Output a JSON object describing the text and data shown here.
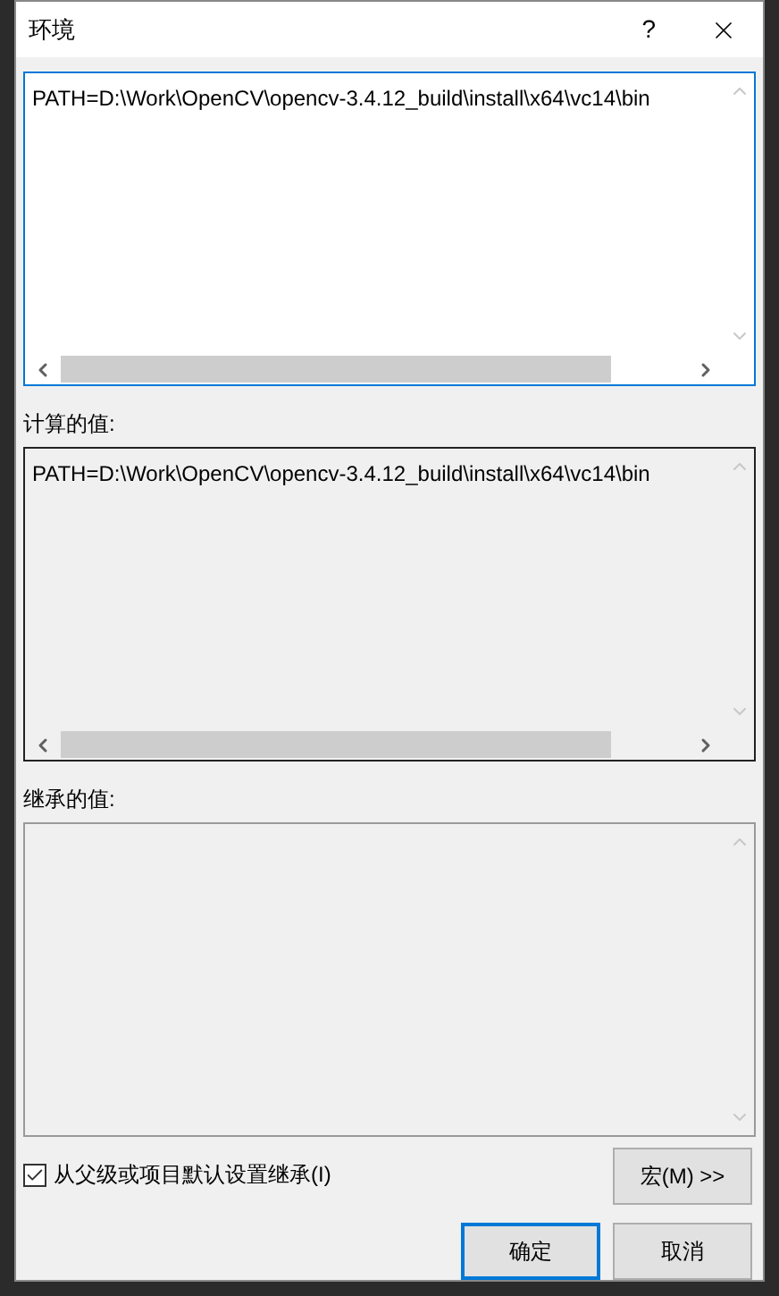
{
  "window": {
    "title": "环境",
    "help": "?"
  },
  "environment": {
    "value": "PATH=D:\\Work\\OpenCV\\opencv-3.4.12_build\\install\\x64\\vc14\\bin"
  },
  "computed": {
    "label": "计算的值:",
    "value": "PATH=D:\\Work\\OpenCV\\opencv-3.4.12_build\\install\\x64\\vc14\\bin"
  },
  "inherited": {
    "label": "继承的值:"
  },
  "inherit_checkbox": {
    "label": "从父级或项目默认设置继承(I)",
    "checked": true
  },
  "macro_button": "宏(M) >>",
  "buttons": [
    {
      "label": "确定",
      "kind": "default"
    },
    {
      "label": "取消",
      "kind": "normal"
    }
  ]
}
